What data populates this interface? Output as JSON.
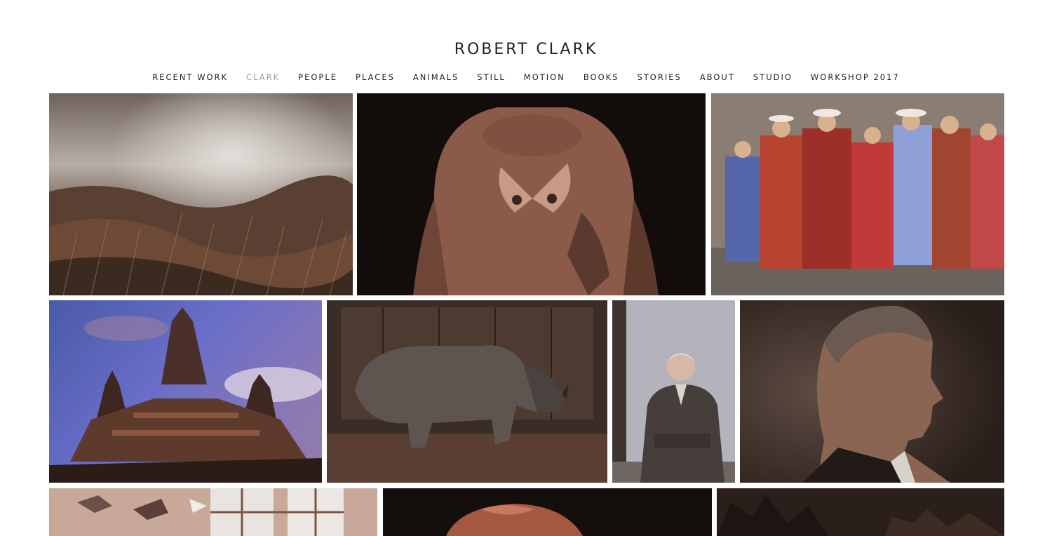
{
  "site": {
    "title": "ROBERT CLARK"
  },
  "nav": {
    "items": [
      {
        "label": "RECENT WORK"
      },
      {
        "label": "CLARK"
      },
      {
        "label": "PEOPLE"
      },
      {
        "label": "PLACES"
      },
      {
        "label": "ANIMALS"
      },
      {
        "label": "STILL"
      },
      {
        "label": "MOTION"
      },
      {
        "label": "BOOKS"
      },
      {
        "label": "STORIES"
      },
      {
        "label": "ABOUT"
      },
      {
        "label": "STUDIO"
      },
      {
        "label": "WORKSHOP 2017"
      }
    ],
    "active": "CLARK"
  },
  "gallery": {
    "images": [
      {
        "subject": "stormy-grassland-landscape"
      },
      {
        "subject": "bare-chest-with-moth"
      },
      {
        "subject": "andean-women-and-children"
      },
      {
        "subject": "angkor-temple-at-dusk"
      },
      {
        "subject": "rhinoceros-in-stall"
      },
      {
        "subject": "seated-elderly-man-portrait"
      },
      {
        "subject": "profile-portrait-of-man"
      },
      {
        "subject": "room-with-birds-and-windows"
      },
      {
        "subject": "flamingo-head"
      },
      {
        "subject": "dark-foliage-scene"
      }
    ]
  },
  "colors": {
    "text": "#222222",
    "active_nav": "#9a9a9a",
    "background": "#ffffff"
  }
}
